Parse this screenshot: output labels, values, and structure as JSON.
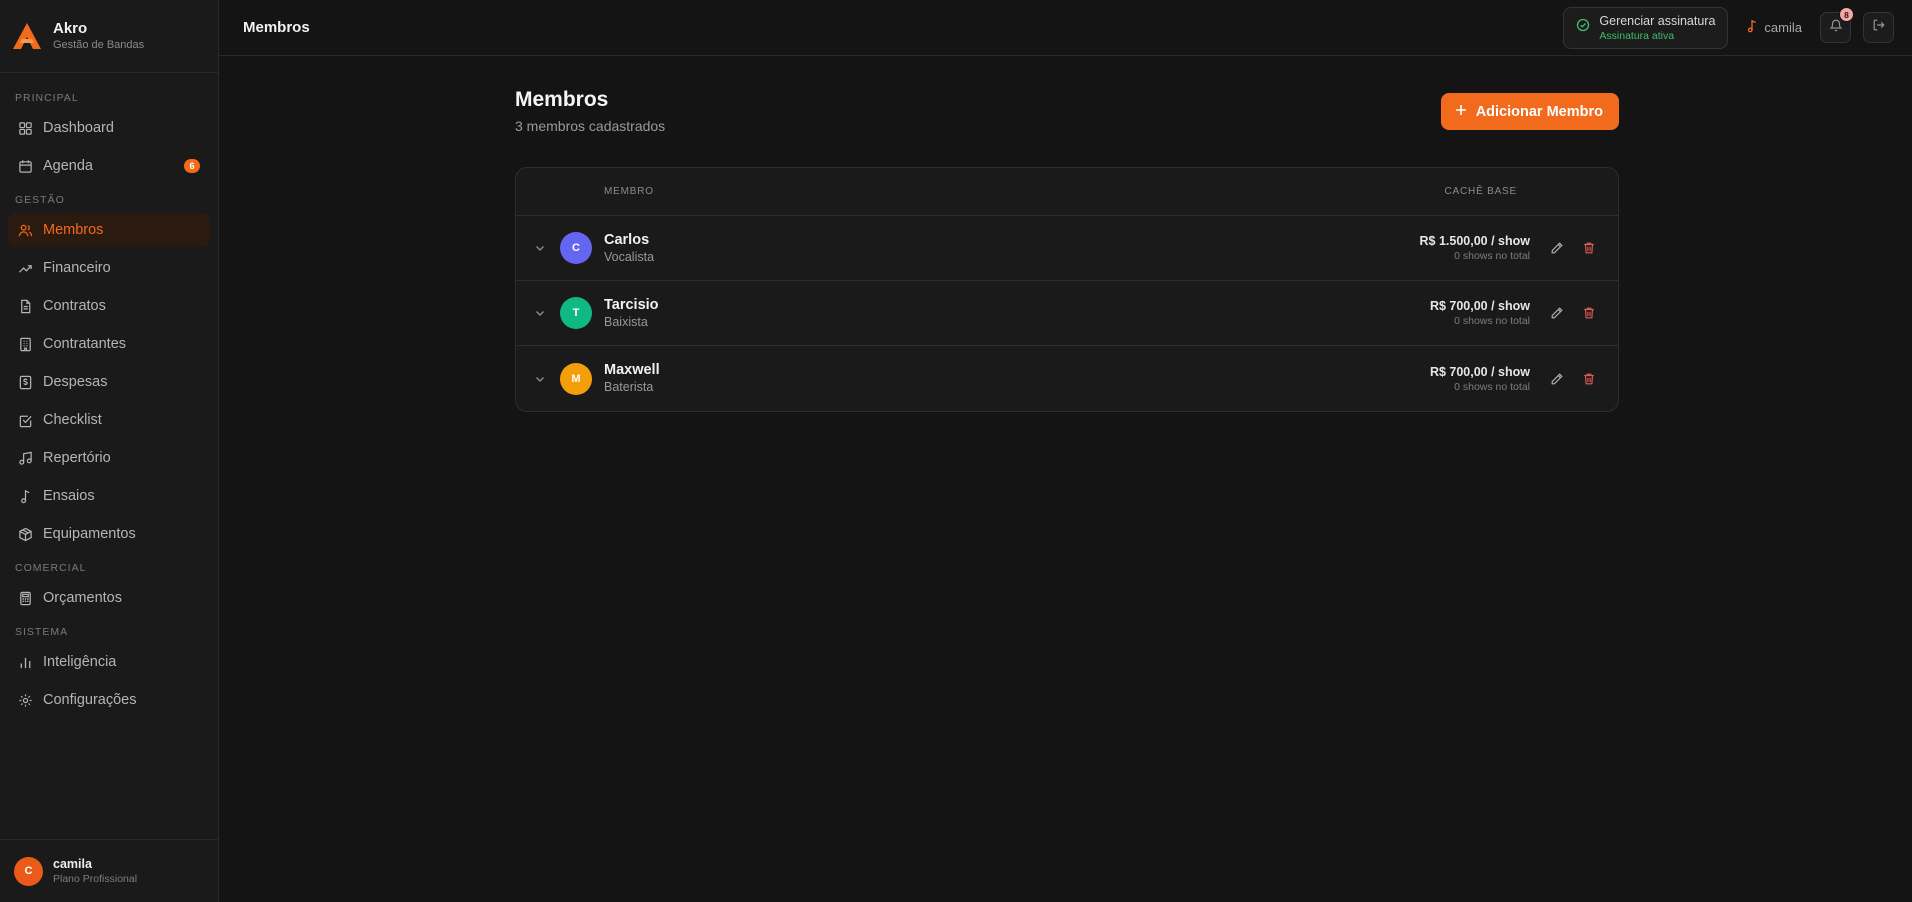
{
  "brand": {
    "name": "Akro",
    "subtitle": "Gestão de Bandas",
    "accent": "#f26b1d"
  },
  "sidebar": {
    "sections": {
      "principal": "PRINCIPAL",
      "gestao": "GESTÃO",
      "comercial": "COMERCIAL",
      "sistema": "SISTEMA"
    },
    "items": {
      "dashboard": {
        "label": "Dashboard",
        "icon": "grid-icon"
      },
      "agenda": {
        "label": "Agenda",
        "icon": "calendar-icon",
        "badge": "6"
      },
      "membros": {
        "label": "Membros",
        "icon": "users-icon",
        "active": true
      },
      "financeiro": {
        "label": "Financeiro",
        "icon": "trending-up-icon"
      },
      "contratos": {
        "label": "Contratos",
        "icon": "file-icon"
      },
      "contratantes": {
        "label": "Contratantes",
        "icon": "building-icon"
      },
      "despesas": {
        "label": "Despesas",
        "icon": "receipt-icon"
      },
      "checklist": {
        "label": "Checklist",
        "icon": "checkbox-icon"
      },
      "repertorio": {
        "label": "Repertório",
        "icon": "music-icon"
      },
      "ensaios": {
        "label": "Ensaios",
        "icon": "music-note-icon"
      },
      "equipamentos": {
        "label": "Equipamentos",
        "icon": "package-icon"
      },
      "orcamentos": {
        "label": "Orçamentos",
        "icon": "calculator-icon"
      },
      "inteligencia": {
        "label": "Inteligência",
        "icon": "bar-chart-icon"
      },
      "configuracoes": {
        "label": "Configurações",
        "icon": "gear-icon"
      }
    },
    "user": {
      "initial": "C",
      "name": "camila",
      "plan": "Plano Profissional"
    }
  },
  "topbar": {
    "title": "Membros",
    "subscription": {
      "title": "Gerenciar assinatura",
      "status": "Assinatura ativa"
    },
    "user_name": "camila",
    "notifications": "8"
  },
  "page": {
    "title": "Membros",
    "subtitle": "3 membros cadastrados",
    "add_button": "Adicionar Membro"
  },
  "table": {
    "columns": {
      "member": "MEMBRO",
      "cache": "CACHÊ BASE"
    },
    "rows": [
      {
        "initial": "C",
        "name": "Carlos",
        "role": "Vocalista",
        "cache": "R$ 1.500,00 / show",
        "shows": "0 shows no total",
        "color": "#6366f1"
      },
      {
        "initial": "T",
        "name": "Tarcisio",
        "role": "Baixista",
        "cache": "R$ 700,00 / show",
        "shows": "0 shows no total",
        "color": "#10b981"
      },
      {
        "initial": "M",
        "name": "Maxwell",
        "role": "Baterista",
        "cache": "R$ 700,00 / show",
        "shows": "0 shows no total",
        "color": "#f59e0b"
      }
    ]
  }
}
